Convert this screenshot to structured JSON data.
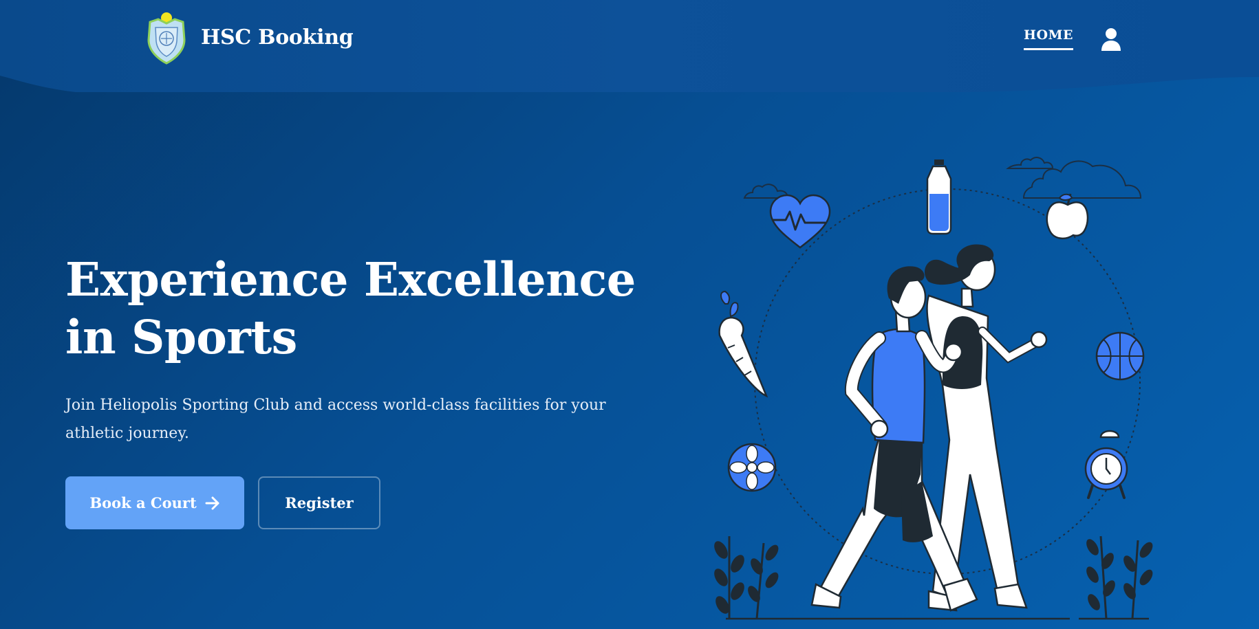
{
  "header": {
    "brand_name": "HSC Booking",
    "nav_home": "HOME",
    "user_icon": "user-icon",
    "logo_icon": "club-crest-icon"
  },
  "hero": {
    "title_line1": "Experience Excellence",
    "title_line2": "in Sports",
    "subtitle_line1": "Join Heliopolis Sporting Club and access world-class facilities for your",
    "subtitle_line2": "athletic journey.",
    "primary_button": "Book a Court",
    "primary_button_icon": "arrow-right-icon",
    "secondary_button": "Register"
  },
  "colors": {
    "background_start": "#05386b",
    "background_end": "#0661b0",
    "primary_button": "#63a3f7",
    "accent_blue": "#3d7bf5",
    "ink": "#1f2a33"
  }
}
